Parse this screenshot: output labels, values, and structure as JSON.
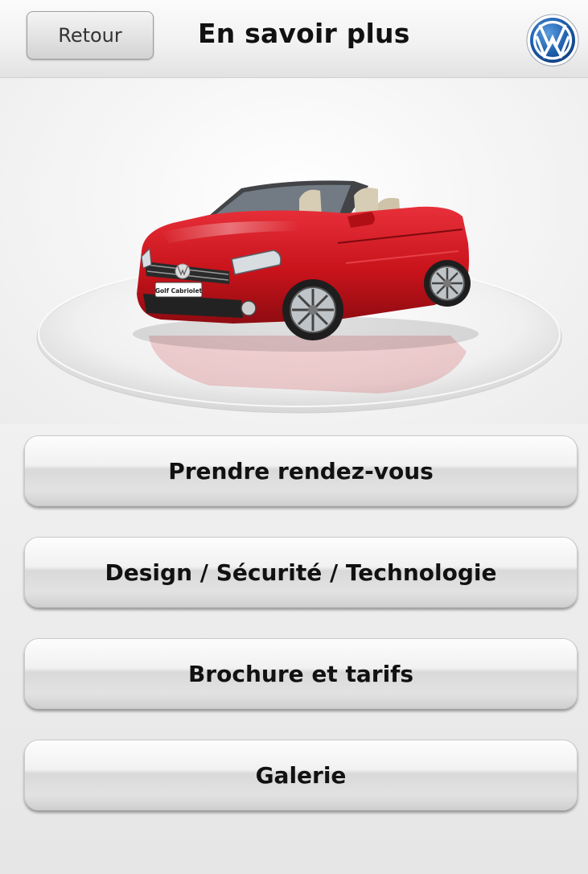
{
  "header": {
    "back_label": "Retour",
    "title": "En savoir plus",
    "logo": "vw-logo-icon"
  },
  "hero": {
    "plate_text": "Golf Cabriolet",
    "car_color": "#c8131b"
  },
  "menu": {
    "items": [
      {
        "label": "Prendre rendez-vous"
      },
      {
        "label": "Design / Sécurité / Technologie"
      },
      {
        "label": "Brochure et tarifs"
      },
      {
        "label": "Galerie"
      }
    ]
  },
  "colors": {
    "accent": "#2a6db5",
    "text": "#111111",
    "background": "#eeeeee"
  }
}
